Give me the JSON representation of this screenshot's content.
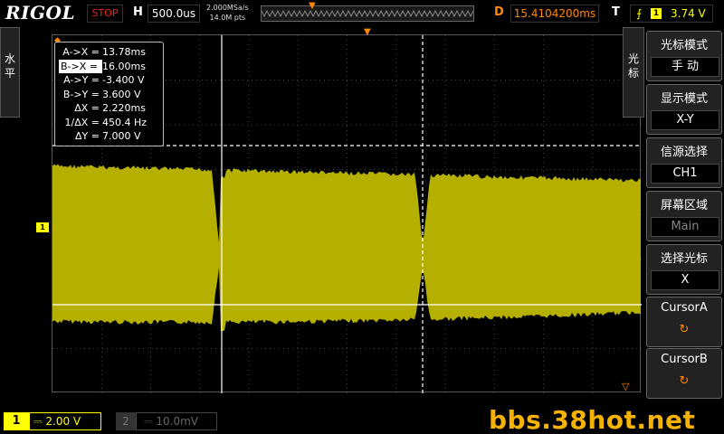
{
  "top_bar": {
    "brand": "RIGOL",
    "run_state": "STOP",
    "horizontal_label": "H",
    "timebase": "500.0us",
    "sample_rate": "2.000MSa/s",
    "memory_depth": "14.0M pts",
    "delay_label": "D",
    "delay": "15.4104200ms",
    "trigger_label": "T",
    "trigger_channel": "1",
    "trigger_level": "3.74 V"
  },
  "left_tab": {
    "label": "水平"
  },
  "channel_marker": "1",
  "cursor_readout": {
    "rows": [
      {
        "key": "A->X =",
        "value": "13.78ms",
        "selected": false
      },
      {
        "key": "B->X =",
        "value": "16.00ms",
        "selected": true
      },
      {
        "key": "A->Y =",
        "value": "-3.400 V",
        "selected": false
      },
      {
        "key": "B->Y =",
        "value": "3.600 V",
        "selected": false
      },
      {
        "key": "ΔX =",
        "value": "2.220ms",
        "selected": false
      },
      {
        "key": "1/ΔX =",
        "value": "450.4 Hz",
        "selected": false
      },
      {
        "key": "ΔY =",
        "value": "7.000 V",
        "selected": false
      }
    ]
  },
  "right_tab": {
    "label": "光标"
  },
  "menu": {
    "items": [
      {
        "title": "光标模式",
        "value": "手  动"
      },
      {
        "title": "显示模式",
        "value": "X-Y"
      },
      {
        "title": "信源选择",
        "value": "CH1"
      },
      {
        "title": "屏幕区域",
        "value": "Main"
      },
      {
        "title": "选择光标",
        "value": "X"
      },
      {
        "title": "CursorA",
        "value": "↻"
      },
      {
        "title": "CursorB",
        "value": "↻"
      }
    ]
  },
  "bottom_bar": {
    "ch1_number": "1",
    "ch1_scale": "2.00 V",
    "ch2_number": "2",
    "ch2_scale": "10.0mV"
  },
  "watermark": "bbs.38hot.net",
  "colors": {
    "ch1_trace": "#b5b000",
    "accent_orange": "#ff8800",
    "ch1_yellow": "#ffff00",
    "watermark": "#f6b200"
  }
}
